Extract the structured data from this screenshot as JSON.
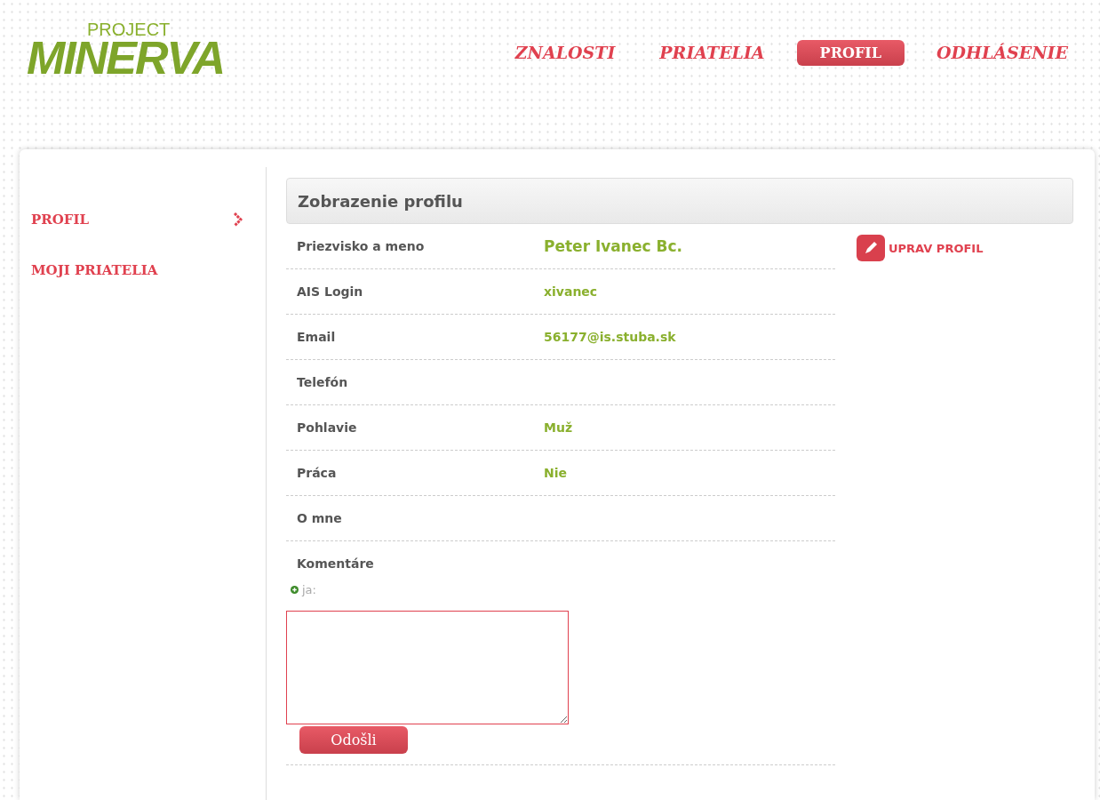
{
  "logo": {
    "small": "PROJECT",
    "big": "MINERVA"
  },
  "nav": [
    {
      "label": "ZNALOSTI",
      "selected": false
    },
    {
      "label": "PRIATELIA",
      "selected": false
    },
    {
      "label": "PROFIL",
      "selected": true
    },
    {
      "label": "ODHLÁSENIE",
      "selected": false
    }
  ],
  "sidebar": {
    "items": [
      {
        "label": "PROFIL",
        "selected": true
      },
      {
        "label": "MOJI PRIATELIA",
        "selected": false
      }
    ]
  },
  "panel": {
    "title": "Zobrazenie profilu",
    "edit_link": "UPRAV PROFIL",
    "rows": [
      {
        "label": "Priezvisko a meno",
        "value": "Peter Ivanec Bc.",
        "kind": "name"
      },
      {
        "label": "AIS Login",
        "value": "xivanec",
        "kind": "text"
      },
      {
        "label": "Email",
        "value": "56177@is.stuba.sk",
        "kind": "text"
      },
      {
        "label": "Telefón",
        "kind": "text"
      },
      {
        "label": "Pohlavie",
        "value": "Muž",
        "kind": "text"
      },
      {
        "label": "Práca",
        "value": "Nie",
        "kind": "text"
      },
      {
        "label": "O mne",
        "kind": "text"
      }
    ]
  },
  "comments": {
    "heading": "Komentáre",
    "author": "ja:",
    "submit": "Odošli"
  }
}
